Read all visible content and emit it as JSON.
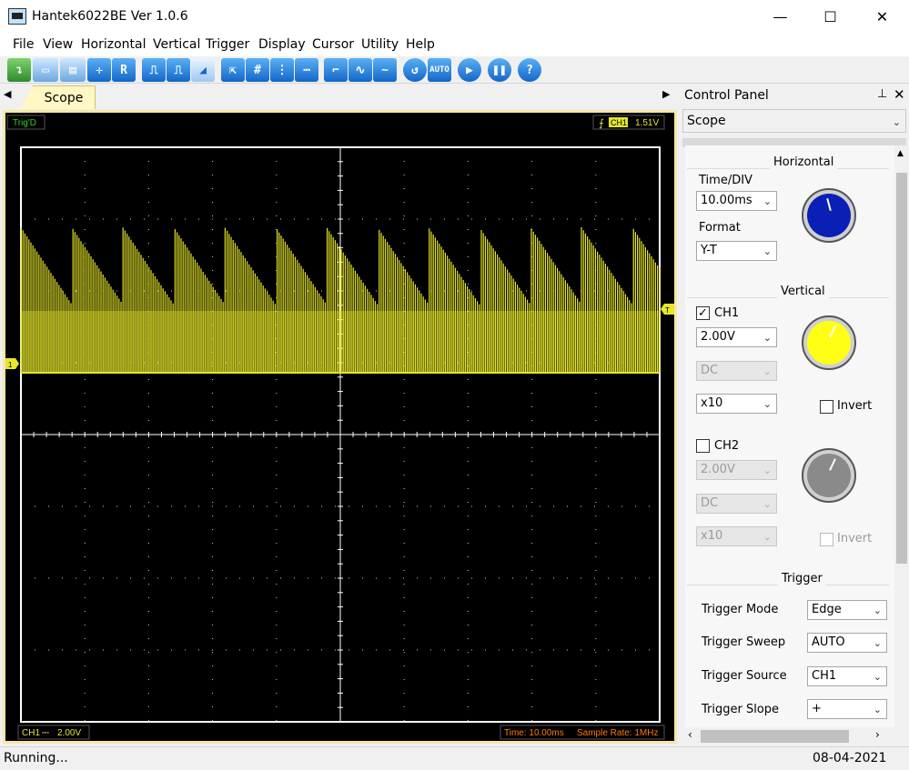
{
  "window": {
    "title": "Hantek6022BE Ver 1.0.6",
    "minimize": "—",
    "maximize": "☐",
    "close": "✕"
  },
  "menu": [
    "File",
    "View",
    "Horizontal",
    "Vertical",
    "Trigger",
    "Display",
    "Cursor",
    "Utility",
    "Help"
  ],
  "toolbar": {
    "buttons": [
      "save-icon",
      "print-icon",
      "zoom-icon",
      "R",
      "pulse-icon",
      "pulse-icon-2",
      "ramp-icon",
      "cursor-icon",
      "grid-icon",
      "vbar-icon",
      "hbar-icon",
      "step-icon",
      "wave-icon",
      "sine-icon",
      "undo-icon",
      "AUTO",
      "run-icon",
      "pause-icon",
      "?"
    ]
  },
  "tabs": {
    "left_arrow": "◀",
    "right_arrow": "▶",
    "active": "Scope"
  },
  "scope": {
    "trig_status": "Trig'D",
    "trig_channel": "CH1",
    "trig_level": "1.51V",
    "ch1_marker": "1",
    "trigger_marker": "T",
    "bottom_ch": "CH1",
    "bottom_coupling": "⎓",
    "bottom_volts": "2.00V",
    "time_info": "Time: 10.00ms",
    "sample_rate": "Sample Rate: 1MHz",
    "wave_color": "#e6e62a",
    "grid_color": "#ffffff"
  },
  "status": {
    "text": "Running...",
    "date": "08-04-2021"
  },
  "control_panel": {
    "title": "Control Panel",
    "pin": "⊥",
    "close": "✕",
    "mode": "Scope",
    "horizontal": {
      "title": "Horizontal",
      "time_div_label": "Time/DIV",
      "time_div": "10.00ms",
      "format_label": "Format",
      "format": "Y-T",
      "knob_color": "#0a1fb5"
    },
    "vertical": {
      "title": "Vertical",
      "ch1": {
        "label": "CH1",
        "checked": "✓",
        "volts": "2.00V",
        "coupling": "DC",
        "probe": "x10",
        "invert": "Invert",
        "knob_color": "#ffff14"
      },
      "ch2": {
        "label": "CH2",
        "volts": "2.00V",
        "coupling": "DC",
        "probe": "x10",
        "invert": "Invert",
        "knob_color": "#8a8a8a"
      }
    },
    "trigger": {
      "title": "Trigger",
      "rows": [
        {
          "label": "Trigger Mode",
          "value": "Edge"
        },
        {
          "label": "Trigger Sweep",
          "value": "AUTO"
        },
        {
          "label": "Trigger Source",
          "value": "CH1"
        },
        {
          "label": "Trigger Slope",
          "value": "+"
        }
      ]
    }
  }
}
